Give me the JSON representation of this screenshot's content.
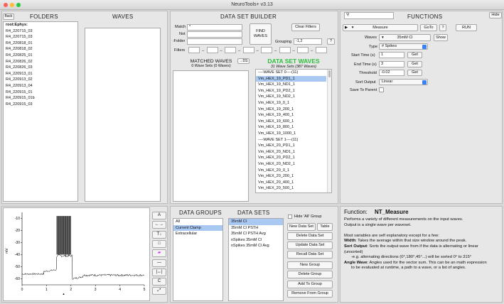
{
  "window": {
    "title": "NeuroTools+ v3.13"
  },
  "colors": {
    "accent": "#2bbf3b",
    "selection": "#a9c8f2"
  },
  "left": {
    "back_label": "Back",
    "folders_title": "FOLDERS",
    "waves_title": "WAVES",
    "root": "root:Ephys:",
    "folders": [
      "R4_220715_03",
      "R4_220715_03",
      "R4_220818_01",
      "R4_220818_02",
      "R4_220825_01",
      "R4_220826_02",
      "R4_220826_03",
      "R4_220913_01",
      "R4_220913_02",
      "R4_220913_04",
      "R4_220915_01",
      "R4_220915_01b",
      "R4_220915_03"
    ]
  },
  "builder": {
    "title": "DATA SET BUILDER",
    "match_label": "Match",
    "match_value": "*",
    "not_label": "Not",
    "folder_label": ":Folder",
    "filters_label": "Filters",
    "find_label": "FIND\nWAVES",
    "clear_label": "Clear Filters",
    "grouping_label": "Grouping",
    "grouping_value": "-1,2",
    "help_label": "?",
    "filter_sep": "_",
    "matched_title": "MATCHED WAVES",
    "matched_count": "0 Wave Sets (0 Waves)",
    "ds_btn": "→DS",
    "dsw_title": "DATA SET WAVES",
    "dsw_count": "31 Wave Sets (387 Waves)",
    "dsw_items": [
      "----WAVE SET 0----(11)",
      "Vm_HEX_19_PD1_1",
      "Vm_HEX_19_ND1_1",
      "Vm_HEX_19_PD2_1",
      "Vm_HEX_19_ND2_1",
      "Vm_HEX_19_0_1",
      "Vm_HEX_19_200_1",
      "Vm_HEX_19_400_1",
      "Vm_HEX_19_600_1",
      "Vm_HEX_19_800_1",
      "Vm_HEX_19_1000_1",
      "----WAVE SET 1----(11)",
      "Vm_HEX_20_PD1_1",
      "Vm_HEX_20_ND1_1",
      "Vm_HEX_20_PD2_1",
      "Vm_HEX_20_ND2_1",
      "Vm_HEX_20_0_1",
      "Vm_HEX_20_200_1",
      "Vm_HEX_20_400_1",
      "Vm_HEX_20_500_1"
    ]
  },
  "functions": {
    "title": "FUNCTIONS",
    "hide_label": "Hide",
    "arrow": "▶",
    "func_value": "Measure",
    "goto_label": "GoTo",
    "help_label": "?",
    "run_label": "RUN",
    "waves_label": "Waves",
    "waves_value": "35mM Cl",
    "show_label": "Show",
    "type_label": "Type",
    "type_value": "# Spikes",
    "start_label": "Start Time (s)",
    "start_value": "1",
    "end_label": "End Time (s)",
    "end_value": "3",
    "threshold_label": "Threshold",
    "threshold_value": "-0.02",
    "get_label": "Get",
    "sort_label": "Sort Output",
    "sort_value": "Linear",
    "save_label": "Save To Parent"
  },
  "plot": {
    "ylabel": "mV",
    "xticks": [
      "0",
      "1",
      "2",
      "3",
      "4",
      "5"
    ],
    "yticks": [
      "-10",
      "-20",
      "-30",
      "-40",
      "-50",
      "-60"
    ],
    "tools": [
      "A",
      "←→",
      "T↓",
      "□",
      "▰",
      "—",
      "|↔|",
      "C",
      "⤢"
    ]
  },
  "groups": {
    "title": "DATA GROUPS",
    "items": [
      "All",
      "Current Clamp",
      "Extracellular"
    ],
    "selected": 1
  },
  "sets": {
    "title": "DATA SETS",
    "items": [
      "35mM Cl",
      "35mM Cl PSTH",
      "35mM Cl PSTH Avg",
      "nSpikes 35mM Cl",
      "nSpikes 35mM Cl Avg"
    ],
    "selected": 0,
    "hide_all": "Hide 'All' Group",
    "new_ds": "New Data Set",
    "table": "Table",
    "delete_ds": "Delete Data Set",
    "update_ds": "Update Data Set",
    "recall_ds": "Recall Data Set",
    "new_group": "New Group",
    "delete_group": "Delete Group",
    "add_group": "Add To Group",
    "remove_group": "Remove From Group"
  },
  "helptext": {
    "label": "Function:",
    "name": "NT_Measure",
    "lines": [
      "Performs a variety of different measurements on the input waves.",
      "Output is a single wave per waveset.",
      "",
      "Most variables are self explanatory except for a few:"
    ],
    "width_key": "Width",
    "width_text": ": Takes the average within that size window around the peak.",
    "sort_key": "Sort Output",
    "sort_text": ": Sorts the output wave from if the data is alternating or linear",
    "sort_text2": "(unsorted)",
    "sort_text3": "-e.g. alternating directions (0°,180°,45°...) will be sorted 0° to 315°",
    "angle_key": "Angle Wave",
    "angle_text": ": Angles used for the vector sum. This can be an math expression",
    "angle_text2": "to be evaluated at runtime, a path to a wave, or a list of angles."
  }
}
